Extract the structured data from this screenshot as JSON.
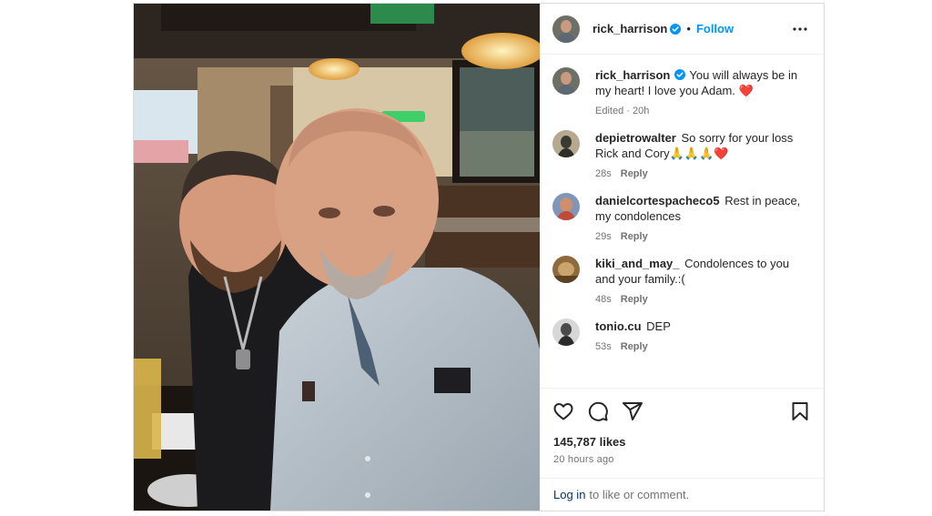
{
  "post": {
    "author": "rick_harrison",
    "separator": "•",
    "follow_label": "Follow",
    "photo_alt": ""
  },
  "comments": [
    {
      "user": "rick_harrison",
      "text": "You will always be in my heart! I love you Adam. ",
      "emoji": "❤️",
      "meta": "Edited · 20h",
      "reply": "",
      "verified": true
    },
    {
      "user": "depietrowalter",
      "text": "So sorry for your loss Rick and Cory",
      "emoji": "🙏🙏🙏❤️",
      "meta": "28s",
      "reply": "Reply"
    },
    {
      "user": "danielcortespacheco5",
      "text": "Rest in peace, my condolences",
      "emoji": "",
      "meta": "29s",
      "reply": "Reply"
    },
    {
      "user": "kiki_and_may_",
      "text": "Condolences to you and your family.:(",
      "emoji": "",
      "meta": "48s",
      "reply": "Reply"
    },
    {
      "user": "tonio.cu",
      "text": "DEP",
      "emoji": "",
      "meta": "53s",
      "reply": "Reply"
    }
  ],
  "engagement": {
    "likes": "145,787 likes",
    "timestamp": "20 HOURS AGO",
    "timestamp_display": "20 hours ago"
  },
  "login": {
    "link_label": "Log in",
    "suffix": "to like or comment."
  },
  "icons": {
    "verified": "verified-badge-icon",
    "more": "more-options-icon",
    "like": "heart-icon",
    "comment": "comment-icon",
    "share": "share-icon",
    "save": "bookmark-icon"
  },
  "colors": {
    "accent": "#0095f6",
    "verified": "#0095f6",
    "link": "#00376b",
    "muted": "#737373",
    "border": "#dbdbdb"
  }
}
